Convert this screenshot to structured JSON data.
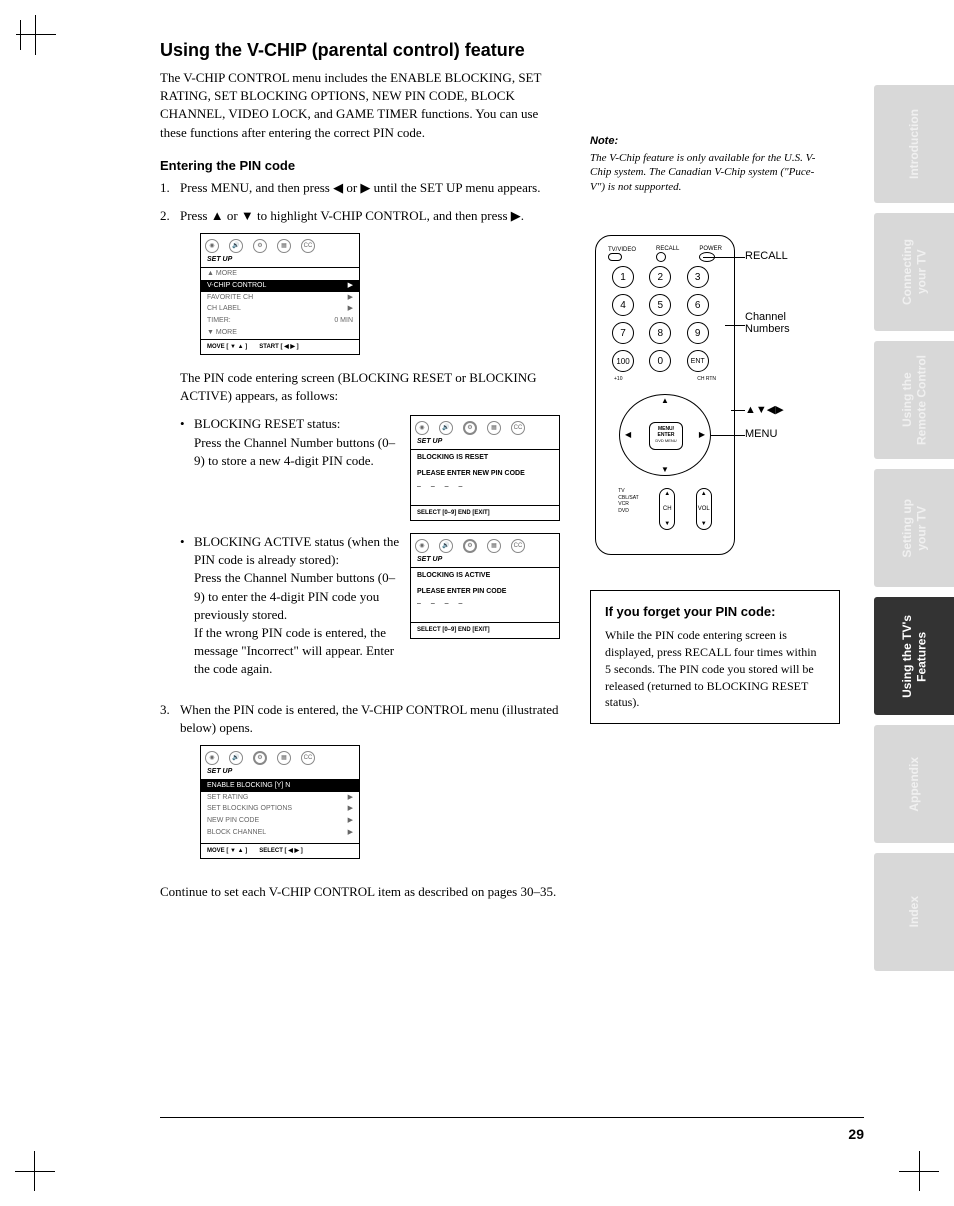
{
  "heading": "Using the V-CHIP (parental control) feature",
  "intro": "The V-CHIP CONTROL menu includes the ENABLE BLOCKING, SET RATING, SET BLOCKING OPTIONS, NEW PIN CODE, BLOCK CHANNEL, VIDEO LOCK, and GAME TIMER functions. You can use these functions after entering the correct PIN code.",
  "subhead": "Entering the PIN code",
  "step1": "Press MENU, and then press ◀ or ▶ until the SET UP menu appears.",
  "step2": "Press ▲ or ▼ to highlight V-CHIP CONTROL, and then press ▶.",
  "step2_after": "The PIN code entering screen (BLOCKING RESET or BLOCKING ACTIVE) appears, as follows:",
  "bullet1_title": "BLOCKING RESET status:",
  "bullet1_body": "Press the Channel Number buttons (0–9) to store a new 4-digit PIN code.",
  "bullet2_title": "BLOCKING ACTIVE status (when the PIN code is already stored):",
  "bullet2_body1": "Press the Channel Number buttons (0–9) to enter the 4-digit PIN code you previously stored.",
  "bullet2_body2": "If the wrong PIN code is entered, the message \"Incorrect\" will appear. Enter the code again.",
  "step3": "When the PIN code is entered, the V-CHIP CONTROL menu (illustrated below) opens.",
  "continue": "Continue to set each V-CHIP CONTROL item as described on pages 30–35.",
  "note_head": "Note:",
  "note_body": "The V-Chip feature is only available for the U.S. V-Chip system. The Canadian V-Chip system (\"Puce-V\") is not supported.",
  "tip_title": "If you forget your PIN code:",
  "tip_body": "While the PIN code entering screen is displayed, press RECALL four times within 5 seconds. The PIN code you stored will be released (returned to BLOCKING RESET status).",
  "osd": {
    "title": "SET UP",
    "more_up": "▲ MORE",
    "vchip": "V-CHIP CONTROL",
    "favorite": "FAVORITE CH",
    "chlabel": "CH LABEL",
    "timer": "TIMER:",
    "timer_val": "0 MIN",
    "more_down": "▼ MORE",
    "foot_move": "MOVE [ ▼ ▲ ]",
    "foot_start": "START [ ◀ ▶ ]",
    "foot_select": "SELECT [ ◀ ▶ ]",
    "reset_msg1": "BLOCKING IS RESET",
    "reset_msg2": "PLEASE ENTER NEW PIN CODE",
    "dashes": "– – – –",
    "reset_foot": "SELECT [0–9]   END [EXIT]",
    "active_msg1": "BLOCKING IS ACTIVE",
    "active_msg2": "PLEASE ENTER PIN CODE",
    "enable": "ENABLE BLOCKING  [Y] N",
    "setrating": "SET RATING",
    "setblock": "SET BLOCKING OPTIONS",
    "newpin": "NEW PIN CODE",
    "blockch": "BLOCK CHANNEL"
  },
  "remote": {
    "tvvideo": "TV/VIDEO",
    "recall_lbl": "RECALL",
    "power": "POWER",
    "n1": "1",
    "n2": "2",
    "n3": "3",
    "n4": "4",
    "n5": "5",
    "n6": "6",
    "n7": "7",
    "n8": "8",
    "n9": "9",
    "n0": "0",
    "n100": "100",
    "ent": "ENT",
    "plus10": "+10",
    "chrtn": "CH RTN",
    "menu": "MENU/\nENTER",
    "dvd": "DVD MENU",
    "ch": "CH",
    "vol": "VOL",
    "side_tv": "TV\nCBL/SAT\nVCR\nDVD",
    "callout_recall": "RECALL",
    "callout_channel": "Channel\nNumbers",
    "callout_arrows": "▲▼◀▶",
    "callout_menu": "MENU"
  },
  "tabs": [
    "Introduction",
    "Connecting\nyour TV",
    "Using the\nRemote Control",
    "Setting up\nyour TV",
    "Using the TV's\nFeatures",
    "Appendix",
    "Index"
  ],
  "page_number": "29"
}
